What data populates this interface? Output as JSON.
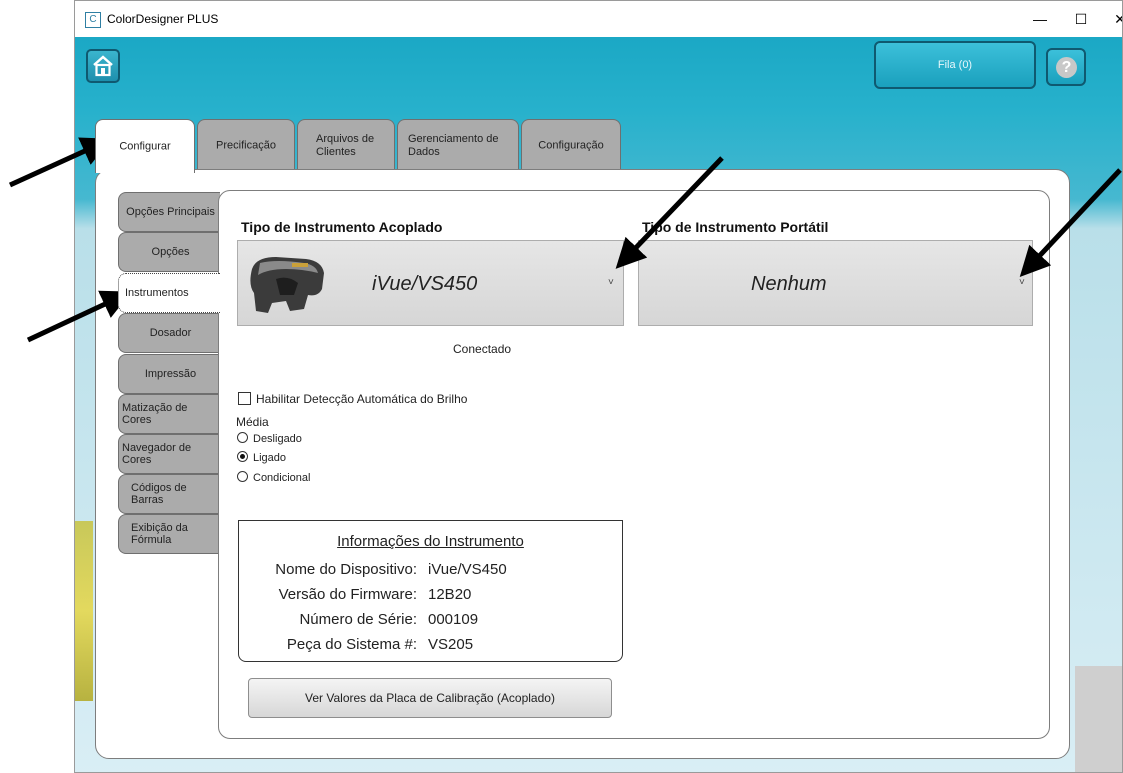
{
  "window": {
    "title": "ColorDesigner PLUS",
    "min_glyph": "—",
    "max_glyph": "☐",
    "close_glyph": "✕"
  },
  "toolbar": {
    "home_icon": "home-icon",
    "queue_label": "Fila (0)",
    "help_glyph": "?"
  },
  "tabs": [
    {
      "label": "Configurar",
      "active": true
    },
    {
      "label": "Precificação",
      "active": false
    },
    {
      "label": "Arquivos de Clientes",
      "active": false
    },
    {
      "label": "Gerenciamento de Dados",
      "active": false
    },
    {
      "label": "Configuração",
      "active": false
    }
  ],
  "side_tabs": [
    {
      "label": "Opções Principais",
      "active": false
    },
    {
      "label": "Opções",
      "active": false
    },
    {
      "label": "Instrumentos",
      "active": true
    },
    {
      "label": "Dosador",
      "active": false
    },
    {
      "label": "Impressão",
      "active": false
    },
    {
      "label": "Matização de Cores",
      "active": false
    },
    {
      "label": "Navegador de Cores",
      "active": false
    },
    {
      "label": "Códigos de Barras",
      "active": false
    },
    {
      "label": "Exibição da Fórmula",
      "active": false
    }
  ],
  "docked": {
    "title": "Tipo de Instrumento Acoplado",
    "value": "iVue/VS450",
    "status": "Conectado"
  },
  "portable": {
    "title": "Tipo de Instrumento Portátil",
    "value": "Nenhum"
  },
  "auto_gloss": {
    "label": "Habilitar Detecção Automática do Brilho",
    "checked": false
  },
  "averaging": {
    "label": "Média",
    "options": [
      {
        "label": "Desligado",
        "selected": false
      },
      {
        "label": "Ligado",
        "selected": true
      },
      {
        "label": "Condicional",
        "selected": false
      }
    ]
  },
  "instrument_info": {
    "title": "Informações do Instrumento",
    "rows": [
      {
        "label": "Nome do Dispositivo:",
        "value": "iVue/VS450"
      },
      {
        "label": "Versão do Firmware:",
        "value": "12B20"
      },
      {
        "label": "Número de Série:",
        "value": "000109"
      },
      {
        "label": "Peça do Sistema #:",
        "value": "VS205"
      }
    ]
  },
  "calibration_button": "Ver Valores da Placa de Calibração (Acoplado)",
  "colors": {
    "accent": "#1aa7c2",
    "tab_inactive": "#ababab",
    "dropdown": "#dcdcdc"
  }
}
